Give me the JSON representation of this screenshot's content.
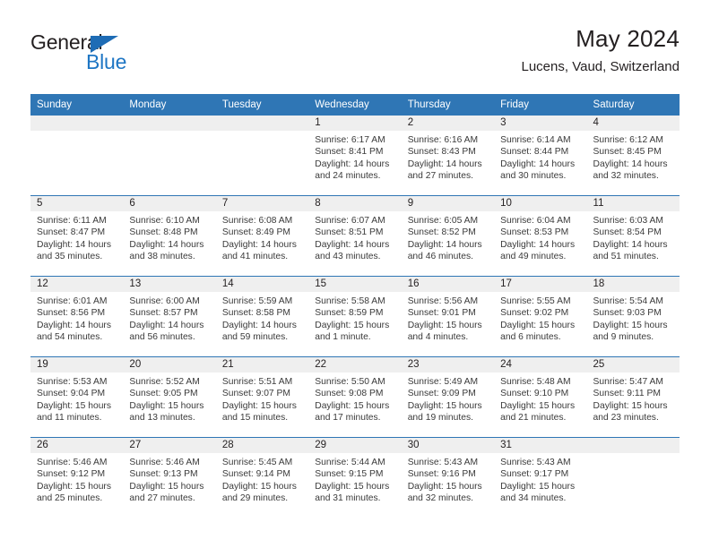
{
  "brand": {
    "name_top": "General",
    "name_bottom": "Blue",
    "accent_color": "#1e76c4",
    "triangle_color": "#1e6cb5"
  },
  "header": {
    "title": "May 2024",
    "subtitle": "Lucens, Vaud, Switzerland",
    "header_bg": "#2f76b5",
    "header_text_color": "#ffffff"
  },
  "weekday_headers": [
    "Sunday",
    "Monday",
    "Tuesday",
    "Wednesday",
    "Thursday",
    "Friday",
    "Saturday"
  ],
  "weeks": [
    [
      {
        "day": "",
        "sunrise": "",
        "sunset": "",
        "daylight_1": "",
        "daylight_2": ""
      },
      {
        "day": "",
        "sunrise": "",
        "sunset": "",
        "daylight_1": "",
        "daylight_2": ""
      },
      {
        "day": "",
        "sunrise": "",
        "sunset": "",
        "daylight_1": "",
        "daylight_2": ""
      },
      {
        "day": "1",
        "sunrise": "Sunrise: 6:17 AM",
        "sunset": "Sunset: 8:41 PM",
        "daylight_1": "Daylight: 14 hours",
        "daylight_2": "and 24 minutes."
      },
      {
        "day": "2",
        "sunrise": "Sunrise: 6:16 AM",
        "sunset": "Sunset: 8:43 PM",
        "daylight_1": "Daylight: 14 hours",
        "daylight_2": "and 27 minutes."
      },
      {
        "day": "3",
        "sunrise": "Sunrise: 6:14 AM",
        "sunset": "Sunset: 8:44 PM",
        "daylight_1": "Daylight: 14 hours",
        "daylight_2": "and 30 minutes."
      },
      {
        "day": "4",
        "sunrise": "Sunrise: 6:12 AM",
        "sunset": "Sunset: 8:45 PM",
        "daylight_1": "Daylight: 14 hours",
        "daylight_2": "and 32 minutes."
      }
    ],
    [
      {
        "day": "5",
        "sunrise": "Sunrise: 6:11 AM",
        "sunset": "Sunset: 8:47 PM",
        "daylight_1": "Daylight: 14 hours",
        "daylight_2": "and 35 minutes."
      },
      {
        "day": "6",
        "sunrise": "Sunrise: 6:10 AM",
        "sunset": "Sunset: 8:48 PM",
        "daylight_1": "Daylight: 14 hours",
        "daylight_2": "and 38 minutes."
      },
      {
        "day": "7",
        "sunrise": "Sunrise: 6:08 AM",
        "sunset": "Sunset: 8:49 PM",
        "daylight_1": "Daylight: 14 hours",
        "daylight_2": "and 41 minutes."
      },
      {
        "day": "8",
        "sunrise": "Sunrise: 6:07 AM",
        "sunset": "Sunset: 8:51 PM",
        "daylight_1": "Daylight: 14 hours",
        "daylight_2": "and 43 minutes."
      },
      {
        "day": "9",
        "sunrise": "Sunrise: 6:05 AM",
        "sunset": "Sunset: 8:52 PM",
        "daylight_1": "Daylight: 14 hours",
        "daylight_2": "and 46 minutes."
      },
      {
        "day": "10",
        "sunrise": "Sunrise: 6:04 AM",
        "sunset": "Sunset: 8:53 PM",
        "daylight_1": "Daylight: 14 hours",
        "daylight_2": "and 49 minutes."
      },
      {
        "day": "11",
        "sunrise": "Sunrise: 6:03 AM",
        "sunset": "Sunset: 8:54 PM",
        "daylight_1": "Daylight: 14 hours",
        "daylight_2": "and 51 minutes."
      }
    ],
    [
      {
        "day": "12",
        "sunrise": "Sunrise: 6:01 AM",
        "sunset": "Sunset: 8:56 PM",
        "daylight_1": "Daylight: 14 hours",
        "daylight_2": "and 54 minutes."
      },
      {
        "day": "13",
        "sunrise": "Sunrise: 6:00 AM",
        "sunset": "Sunset: 8:57 PM",
        "daylight_1": "Daylight: 14 hours",
        "daylight_2": "and 56 minutes."
      },
      {
        "day": "14",
        "sunrise": "Sunrise: 5:59 AM",
        "sunset": "Sunset: 8:58 PM",
        "daylight_1": "Daylight: 14 hours",
        "daylight_2": "and 59 minutes."
      },
      {
        "day": "15",
        "sunrise": "Sunrise: 5:58 AM",
        "sunset": "Sunset: 8:59 PM",
        "daylight_1": "Daylight: 15 hours",
        "daylight_2": "and 1 minute."
      },
      {
        "day": "16",
        "sunrise": "Sunrise: 5:56 AM",
        "sunset": "Sunset: 9:01 PM",
        "daylight_1": "Daylight: 15 hours",
        "daylight_2": "and 4 minutes."
      },
      {
        "day": "17",
        "sunrise": "Sunrise: 5:55 AM",
        "sunset": "Sunset: 9:02 PM",
        "daylight_1": "Daylight: 15 hours",
        "daylight_2": "and 6 minutes."
      },
      {
        "day": "18",
        "sunrise": "Sunrise: 5:54 AM",
        "sunset": "Sunset: 9:03 PM",
        "daylight_1": "Daylight: 15 hours",
        "daylight_2": "and 9 minutes."
      }
    ],
    [
      {
        "day": "19",
        "sunrise": "Sunrise: 5:53 AM",
        "sunset": "Sunset: 9:04 PM",
        "daylight_1": "Daylight: 15 hours",
        "daylight_2": "and 11 minutes."
      },
      {
        "day": "20",
        "sunrise": "Sunrise: 5:52 AM",
        "sunset": "Sunset: 9:05 PM",
        "daylight_1": "Daylight: 15 hours",
        "daylight_2": "and 13 minutes."
      },
      {
        "day": "21",
        "sunrise": "Sunrise: 5:51 AM",
        "sunset": "Sunset: 9:07 PM",
        "daylight_1": "Daylight: 15 hours",
        "daylight_2": "and 15 minutes."
      },
      {
        "day": "22",
        "sunrise": "Sunrise: 5:50 AM",
        "sunset": "Sunset: 9:08 PM",
        "daylight_1": "Daylight: 15 hours",
        "daylight_2": "and 17 minutes."
      },
      {
        "day": "23",
        "sunrise": "Sunrise: 5:49 AM",
        "sunset": "Sunset: 9:09 PM",
        "daylight_1": "Daylight: 15 hours",
        "daylight_2": "and 19 minutes."
      },
      {
        "day": "24",
        "sunrise": "Sunrise: 5:48 AM",
        "sunset": "Sunset: 9:10 PM",
        "daylight_1": "Daylight: 15 hours",
        "daylight_2": "and 21 minutes."
      },
      {
        "day": "25",
        "sunrise": "Sunrise: 5:47 AM",
        "sunset": "Sunset: 9:11 PM",
        "daylight_1": "Daylight: 15 hours",
        "daylight_2": "and 23 minutes."
      }
    ],
    [
      {
        "day": "26",
        "sunrise": "Sunrise: 5:46 AM",
        "sunset": "Sunset: 9:12 PM",
        "daylight_1": "Daylight: 15 hours",
        "daylight_2": "and 25 minutes."
      },
      {
        "day": "27",
        "sunrise": "Sunrise: 5:46 AM",
        "sunset": "Sunset: 9:13 PM",
        "daylight_1": "Daylight: 15 hours",
        "daylight_2": "and 27 minutes."
      },
      {
        "day": "28",
        "sunrise": "Sunrise: 5:45 AM",
        "sunset": "Sunset: 9:14 PM",
        "daylight_1": "Daylight: 15 hours",
        "daylight_2": "and 29 minutes."
      },
      {
        "day": "29",
        "sunrise": "Sunrise: 5:44 AM",
        "sunset": "Sunset: 9:15 PM",
        "daylight_1": "Daylight: 15 hours",
        "daylight_2": "and 31 minutes."
      },
      {
        "day": "30",
        "sunrise": "Sunrise: 5:43 AM",
        "sunset": "Sunset: 9:16 PM",
        "daylight_1": "Daylight: 15 hours",
        "daylight_2": "and 32 minutes."
      },
      {
        "day": "31",
        "sunrise": "Sunrise: 5:43 AM",
        "sunset": "Sunset: 9:17 PM",
        "daylight_1": "Daylight: 15 hours",
        "daylight_2": "and 34 minutes."
      },
      {
        "day": "",
        "sunrise": "",
        "sunset": "",
        "daylight_1": "",
        "daylight_2": ""
      }
    ]
  ]
}
